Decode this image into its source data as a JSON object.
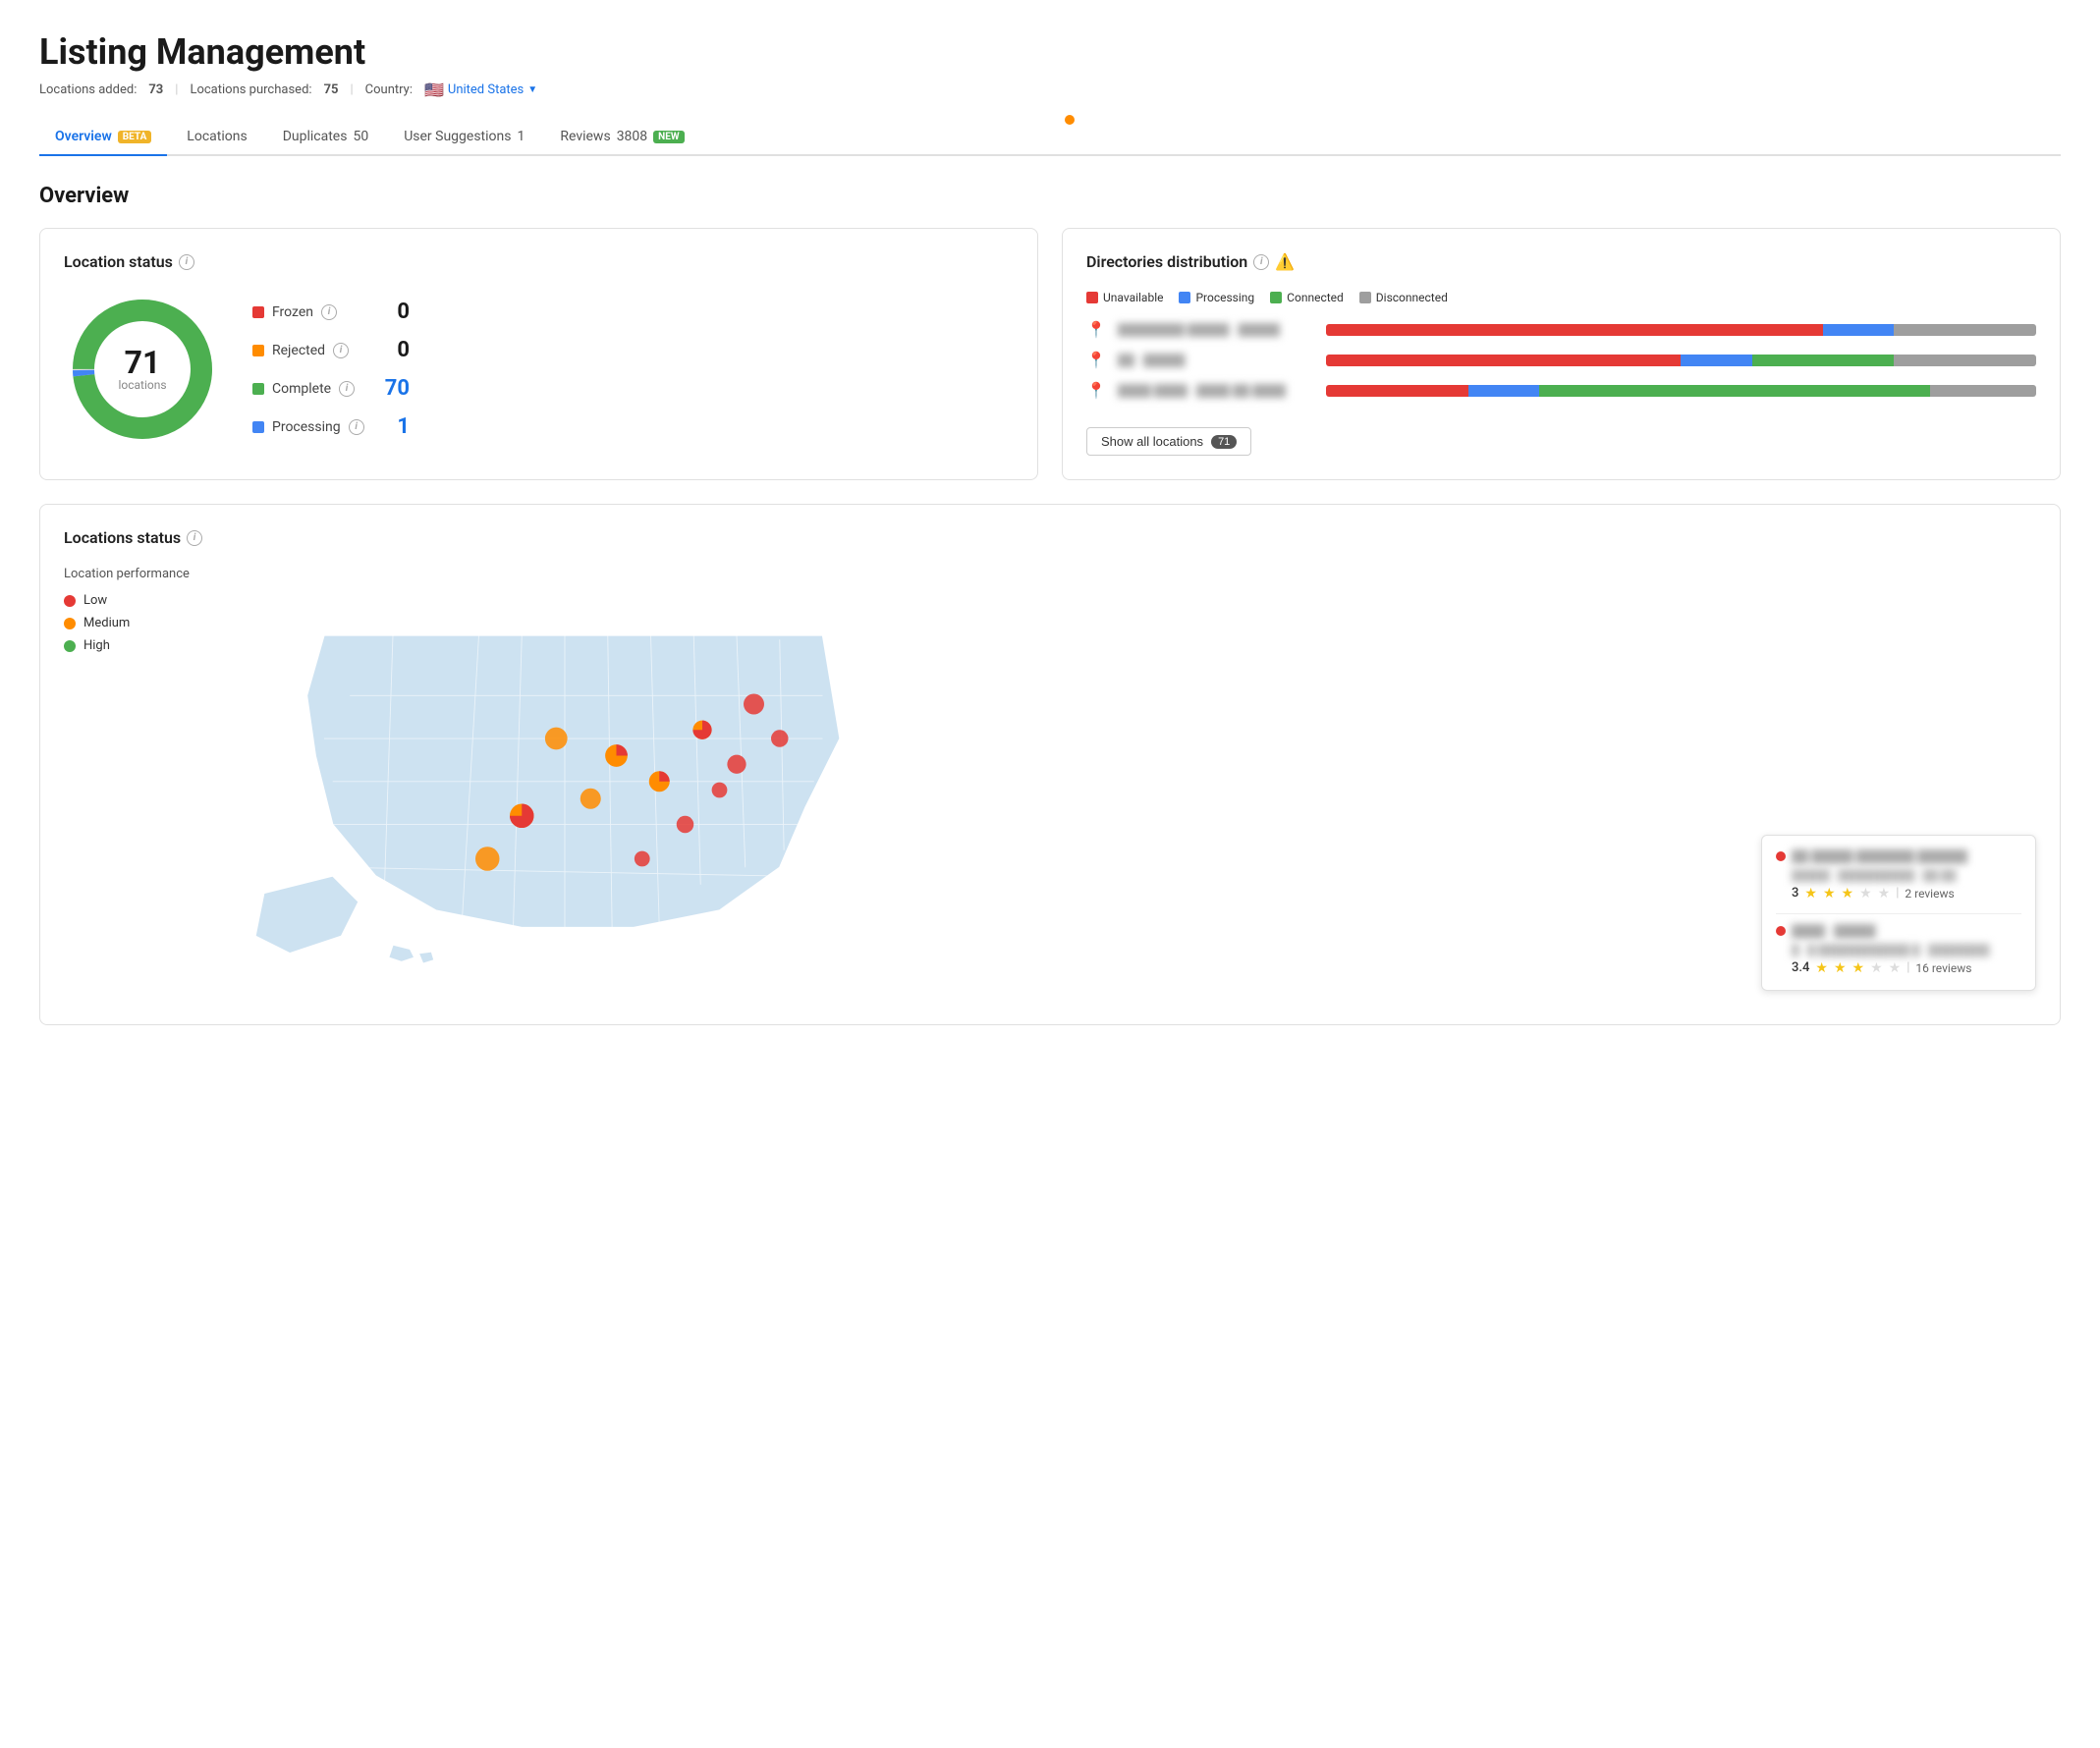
{
  "page": {
    "title": "Listing Management",
    "subtitle": {
      "locations_added_label": "Locations added:",
      "locations_added_value": "73",
      "locations_purchased_label": "Locations purchased:",
      "locations_purchased_value": "75",
      "country_label": "Country:",
      "country_name": "United States"
    }
  },
  "tabs": [
    {
      "id": "overview",
      "label": "Overview",
      "badge": "BETA",
      "badge_type": "beta",
      "active": true
    },
    {
      "id": "locations",
      "label": "Locations",
      "badge": null
    },
    {
      "id": "duplicates",
      "label": "Duplicates",
      "count": "50"
    },
    {
      "id": "user-suggestions",
      "label": "User Suggestions",
      "count": "1"
    },
    {
      "id": "reviews",
      "label": "Reviews",
      "count": "3808",
      "badge": "NEW",
      "badge_type": "new"
    }
  ],
  "overview": {
    "heading": "Overview"
  },
  "location_status": {
    "card_title": "Location status",
    "donut": {
      "total": "71",
      "total_label": "locations",
      "segments": [
        {
          "label": "Complete",
          "color": "#4caf50",
          "value": 70,
          "percentage": 98.6
        },
        {
          "label": "Processing",
          "color": "#4285f4",
          "value": 1,
          "percentage": 1.4
        },
        {
          "label": "Rejected",
          "color": "#ff8c00",
          "value": 0,
          "percentage": 0
        },
        {
          "label": "Frozen",
          "color": "#e53935",
          "value": 0,
          "percentage": 0
        }
      ]
    },
    "items": [
      {
        "label": "Frozen",
        "color": "#e53935",
        "value": "0",
        "zero": true
      },
      {
        "label": "Rejected",
        "color": "#ff8c00",
        "value": "0",
        "zero": true
      },
      {
        "label": "Complete",
        "color": "#4caf50",
        "value": "70",
        "zero": false
      },
      {
        "label": "Processing",
        "color": "#4285f4",
        "value": "1",
        "zero": false
      }
    ]
  },
  "directories": {
    "card_title": "Directories distribution",
    "legend": [
      {
        "label": "Unavailable",
        "color": "#e53935"
      },
      {
        "label": "Processing",
        "color": "#4285f4"
      },
      {
        "label": "Connected",
        "color": "#4caf50"
      },
      {
        "label": "Disconnected",
        "color": "#9e9e9e"
      }
    ],
    "rows": [
      {
        "name": "██████ █████ · █████",
        "segments": [
          {
            "color": "#e53935",
            "width": 55
          },
          {
            "color": "#4285f4",
            "width": 8
          },
          {
            "color": "#4caf50",
            "width": 0
          },
          {
            "color": "#9e9e9e",
            "width": 0
          }
        ]
      },
      {
        "name": "██ · █████",
        "segments": [
          {
            "color": "#e53935",
            "width": 40
          },
          {
            "color": "#4285f4",
            "width": 8
          },
          {
            "color": "#4caf50",
            "width": 15
          },
          {
            "color": "#9e9e9e",
            "width": 0
          }
        ]
      },
      {
        "name": "████ ████ · ████ ██ ████ █·█",
        "segments": [
          {
            "color": "#e53935",
            "width": 15
          },
          {
            "color": "#4285f4",
            "width": 8
          },
          {
            "color": "#4caf50",
            "width": 40
          },
          {
            "color": "#9e9e9e",
            "width": 0
          }
        ]
      }
    ],
    "show_all_label": "Show all locations",
    "show_all_count": "71"
  },
  "locations_status": {
    "card_title": "Locations status",
    "legend_title": "Location performance",
    "legend": [
      {
        "label": "Low",
        "color": "#e53935"
      },
      {
        "label": "Medium",
        "color": "#ff8c00"
      },
      {
        "label": "High",
        "color": "#4caf50"
      }
    ],
    "tooltip": {
      "entries": [
        {
          "name": "██████ ███████ ██████",
          "address": "█████ · ████████████ · ██ ██",
          "rating": "3",
          "reviews": "2 reviews",
          "stars": 3
        },
        {
          "name": "████ · █████",
          "address": "█ · █ ████████████ █ · ████████",
          "rating": "3.4",
          "reviews": "16 reviews",
          "stars": 3.4
        }
      ]
    }
  }
}
